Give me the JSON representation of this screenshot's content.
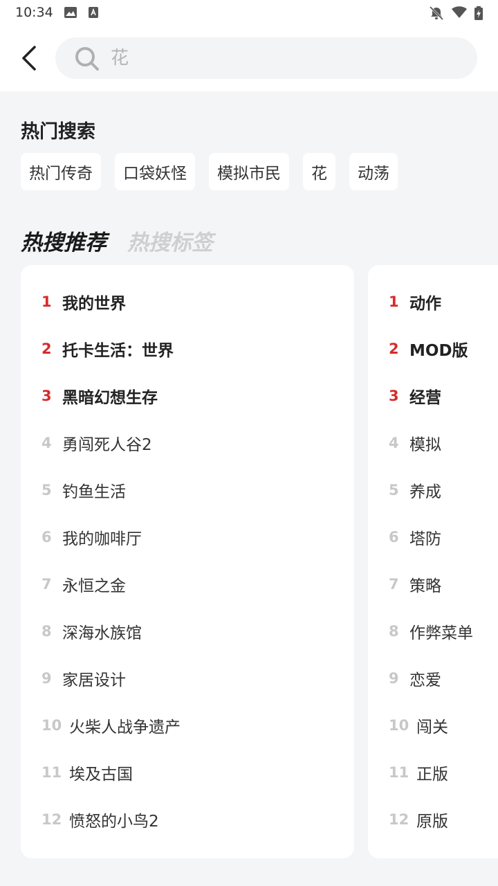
{
  "status_bar": {
    "time": "10:34"
  },
  "search": {
    "placeholder": "花",
    "value": ""
  },
  "hot_search": {
    "title": "热门搜索",
    "tags": [
      "热门传奇",
      "口袋妖怪",
      "模拟市民",
      "花",
      "动荡"
    ]
  },
  "tabs": [
    {
      "label": "热搜推荐",
      "active": true
    },
    {
      "label": "热搜标签",
      "active": false
    }
  ],
  "hot_recommend": [
    {
      "rank": "1",
      "name": "我的世界"
    },
    {
      "rank": "2",
      "name": "托卡生活：世界"
    },
    {
      "rank": "3",
      "name": "黑暗幻想生存"
    },
    {
      "rank": "4",
      "name": "勇闯死人谷2"
    },
    {
      "rank": "5",
      "name": "钓鱼生活"
    },
    {
      "rank": "6",
      "name": "我的咖啡厅"
    },
    {
      "rank": "7",
      "name": "永恒之金"
    },
    {
      "rank": "8",
      "name": "深海水族馆"
    },
    {
      "rank": "9",
      "name": "家居设计"
    },
    {
      "rank": "10",
      "name": "火柴人战争遗产"
    },
    {
      "rank": "11",
      "name": "埃及古国"
    },
    {
      "rank": "12",
      "name": "愤怒的小鸟2"
    }
  ],
  "hot_tags": [
    {
      "rank": "1",
      "name": "动作"
    },
    {
      "rank": "2",
      "name": "MOD版"
    },
    {
      "rank": "3",
      "name": "经营"
    },
    {
      "rank": "4",
      "name": "模拟"
    },
    {
      "rank": "5",
      "name": "养成"
    },
    {
      "rank": "6",
      "name": "塔防"
    },
    {
      "rank": "7",
      "name": "策略"
    },
    {
      "rank": "8",
      "name": "作弊菜单"
    },
    {
      "rank": "9",
      "name": "恋爱"
    },
    {
      "rank": "10",
      "name": "闯关"
    },
    {
      "rank": "11",
      "name": "正版"
    },
    {
      "rank": "12",
      "name": "原版"
    }
  ],
  "colors": {
    "top_rank": "#d72b2b",
    "rank": "#c8c8c8",
    "background": "#f4f5f7"
  }
}
